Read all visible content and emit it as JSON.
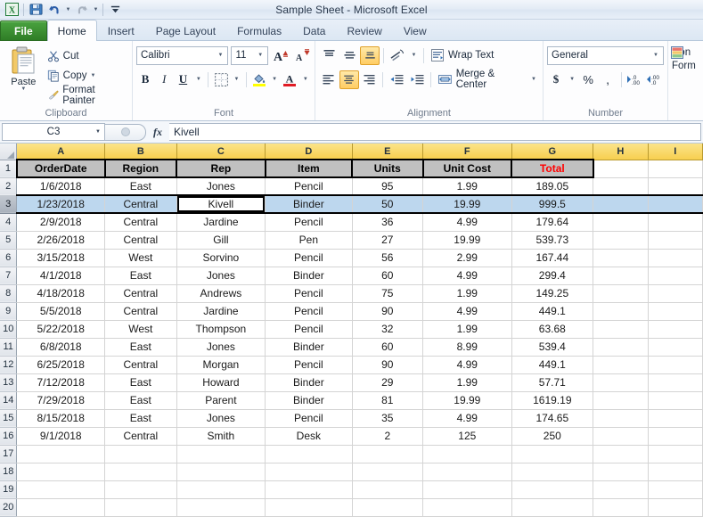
{
  "window": {
    "title": "Sample Sheet  -  Microsoft Excel"
  },
  "quick_access": {
    "app_icon": "excel-icon",
    "items": [
      {
        "name": "save-icon",
        "label": "Save"
      },
      {
        "name": "undo-icon",
        "label": "Undo"
      },
      {
        "name": "redo-icon",
        "label": "Redo"
      },
      {
        "name": "customize-qat-icon",
        "label": "Customize Quick Access Toolbar"
      }
    ]
  },
  "tabs": [
    {
      "label": "File",
      "type": "file"
    },
    {
      "label": "Home",
      "type": "active"
    },
    {
      "label": "Insert",
      "type": "normal"
    },
    {
      "label": "Page Layout",
      "type": "normal"
    },
    {
      "label": "Formulas",
      "type": "normal"
    },
    {
      "label": "Data",
      "type": "normal"
    },
    {
      "label": "Review",
      "type": "normal"
    },
    {
      "label": "View",
      "type": "normal"
    }
  ],
  "ribbon": {
    "clipboard": {
      "title": "Clipboard",
      "paste_label": "Paste",
      "cut_label": "Cut",
      "copy_label": "Copy",
      "format_painter_label": "Format Painter"
    },
    "font": {
      "title": "Font",
      "font_name": "Calibri",
      "font_size": "11",
      "bold_label": "B",
      "italic_label": "I",
      "underline_label": "U",
      "grow_font_label": "A",
      "shrink_font_label": "A"
    },
    "alignment": {
      "title": "Alignment",
      "wrap_text_label": "Wrap Text",
      "merge_center_label": "Merge & Center"
    },
    "number": {
      "title": "Number",
      "format": "General",
      "currency_label": "$",
      "percent_label": "%",
      "comma_label": ","
    },
    "styles": {
      "conditional_formatting_line1": "Con",
      "conditional_formatting_line2": "Form"
    }
  },
  "formula_bar": {
    "name_box": "C3",
    "fx_label": "fx",
    "formula_value": "Kivell"
  },
  "sheet": {
    "column_headers": [
      "A",
      "B",
      "C",
      "D",
      "E",
      "F",
      "G",
      "H",
      "I"
    ],
    "row_headers": [
      "1",
      "2",
      "3",
      "4",
      "5",
      "6",
      "7",
      "8",
      "9",
      "10",
      "11",
      "12",
      "13",
      "14",
      "15",
      "16",
      "17",
      "18",
      "19",
      "20"
    ],
    "header_row": [
      "OrderDate",
      "Region",
      "Rep",
      "Item",
      "Units",
      "Unit Cost",
      "Total"
    ],
    "header_accent_column": "Total",
    "header_accent_color": "#ff0000",
    "selected_row_index": 3,
    "active_cell": "C3",
    "selection_fill": "#bdd7ee",
    "rows": [
      [
        "1/6/2018",
        "East",
        "Jones",
        "Pencil",
        "95",
        "1.99",
        "189.05"
      ],
      [
        "1/23/2018",
        "Central",
        "Kivell",
        "Binder",
        "50",
        "19.99",
        "999.5"
      ],
      [
        "2/9/2018",
        "Central",
        "Jardine",
        "Pencil",
        "36",
        "4.99",
        "179.64"
      ],
      [
        "2/26/2018",
        "Central",
        "Gill",
        "Pen",
        "27",
        "19.99",
        "539.73"
      ],
      [
        "3/15/2018",
        "West",
        "Sorvino",
        "Pencil",
        "56",
        "2.99",
        "167.44"
      ],
      [
        "4/1/2018",
        "East",
        "Jones",
        "Binder",
        "60",
        "4.99",
        "299.4"
      ],
      [
        "4/18/2018",
        "Central",
        "Andrews",
        "Pencil",
        "75",
        "1.99",
        "149.25"
      ],
      [
        "5/5/2018",
        "Central",
        "Jardine",
        "Pencil",
        "90",
        "4.99",
        "449.1"
      ],
      [
        "5/22/2018",
        "West",
        "Thompson",
        "Pencil",
        "32",
        "1.99",
        "63.68"
      ],
      [
        "6/8/2018",
        "East",
        "Jones",
        "Binder",
        "60",
        "8.99",
        "539.4"
      ],
      [
        "6/25/2018",
        "Central",
        "Morgan",
        "Pencil",
        "90",
        "4.99",
        "449.1"
      ],
      [
        "7/12/2018",
        "East",
        "Howard",
        "Binder",
        "29",
        "1.99",
        "57.71"
      ],
      [
        "7/29/2018",
        "East",
        "Parent",
        "Binder",
        "81",
        "19.99",
        "1619.19"
      ],
      [
        "8/15/2018",
        "East",
        "Jones",
        "Pencil",
        "35",
        "4.99",
        "174.65"
      ],
      [
        "9/1/2018",
        "Central",
        "Smith",
        "Desk",
        "2",
        "125",
        "250"
      ]
    ],
    "empty_rows": 4
  }
}
